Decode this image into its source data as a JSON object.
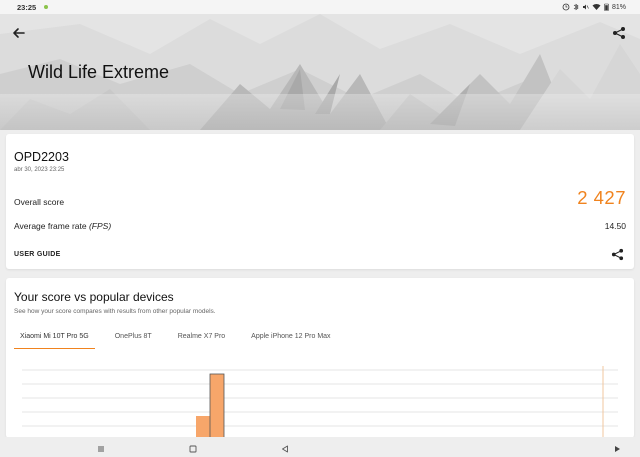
{
  "status_bar": {
    "time": "23:25",
    "battery": "81%"
  },
  "header": {
    "title": "Wild Life Extreme"
  },
  "result": {
    "device_name": "OPD2203",
    "date": "abr 30, 2023 23:25",
    "overall_score_label": "Overall score",
    "overall_score_value": "2 427",
    "fps_label_prefix": "Average frame rate ",
    "fps_label_unit": "(FPS)",
    "fps_value": "14.50",
    "user_guide_label": "USER GUIDE"
  },
  "compare": {
    "title": "Your score vs popular devices",
    "subtitle": "See how your score compares with results from other popular models.",
    "tabs": [
      {
        "label": "Xiaomi Mi 10T Pro 5G",
        "active": true
      },
      {
        "label": "OnePlus 8T",
        "active": false
      },
      {
        "label": "Realme X7 Pro",
        "active": false
      },
      {
        "label": "Apple iPhone 12 Pro Max",
        "active": false
      }
    ]
  },
  "colors": {
    "accent": "#f0831e",
    "bar_fill": "#f7a66a"
  },
  "icons": {
    "back": "arrow-left-icon",
    "share": "share-icon",
    "nav_menu": "menu-icon",
    "nav_home": "square-icon",
    "nav_back": "triangle-back-icon",
    "nav_extra": "play-icon"
  }
}
